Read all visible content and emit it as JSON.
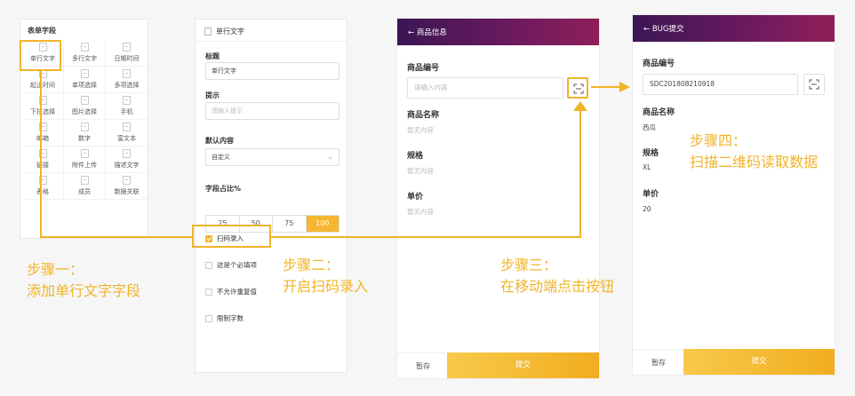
{
  "palette": {
    "title": "表单字段",
    "items": [
      "单行文字",
      "多行文字",
      "日期时间",
      "起止时间",
      "单项选择",
      "多项选择",
      "下拉选择",
      "图片选择",
      "手机",
      "邮箱",
      "数字",
      "富文本",
      "链接",
      "附件上传",
      "描述文字",
      "表格",
      "成员",
      "数据关联"
    ]
  },
  "settings": {
    "header": "单行文字",
    "title_label": "标题",
    "title_value": "单行文字",
    "hint_label": "提示",
    "hint_placeholder": "请输入提示",
    "default_label": "默认内容",
    "default_value": "自定义",
    "width_label": "字段占比%",
    "width_options": [
      "25",
      "50",
      "75",
      "100"
    ],
    "width_selected": "100",
    "checkboxes": [
      {
        "label": "扫码录入",
        "checked": true
      },
      {
        "label": "这是个必填项",
        "checked": false
      },
      {
        "label": "不允许重复值",
        "checked": false
      },
      {
        "label": "限制字数",
        "checked": false
      }
    ]
  },
  "phone1": {
    "back": "←",
    "title": "商品信息",
    "code_label": "商品编号",
    "code_placeholder": "请输入内容",
    "name_label": "商品名称",
    "name_value": "暂无内容",
    "spec_label": "规格",
    "spec_value": "暂无内容",
    "price_label": "单价",
    "price_value": "暂无内容",
    "save": "暂存",
    "submit": "提交"
  },
  "phone2": {
    "back": "←",
    "title": "BUG提交",
    "code_label": "商品编号",
    "code_value": "SDC201808210918",
    "name_label": "商品名称",
    "name_value": "西瓜",
    "spec_label": "规格",
    "spec_value": "XL",
    "price_label": "单价",
    "price_value": "20",
    "save": "暂存",
    "submit": "提交"
  },
  "steps": {
    "s1_a": "步骤一：",
    "s1_b": "添加单行文字字段",
    "s2_a": "步骤二：",
    "s2_b": "开启扫码录入",
    "s3_a": "步骤三：",
    "s3_b": "在移动端点击按钮",
    "s4_a": "步骤四：",
    "s4_b": "扫描二维码读取数据"
  },
  "colors": {
    "accent": "#f0b429",
    "header_start": "#3b1654",
    "header_end": "#8f1f58"
  }
}
